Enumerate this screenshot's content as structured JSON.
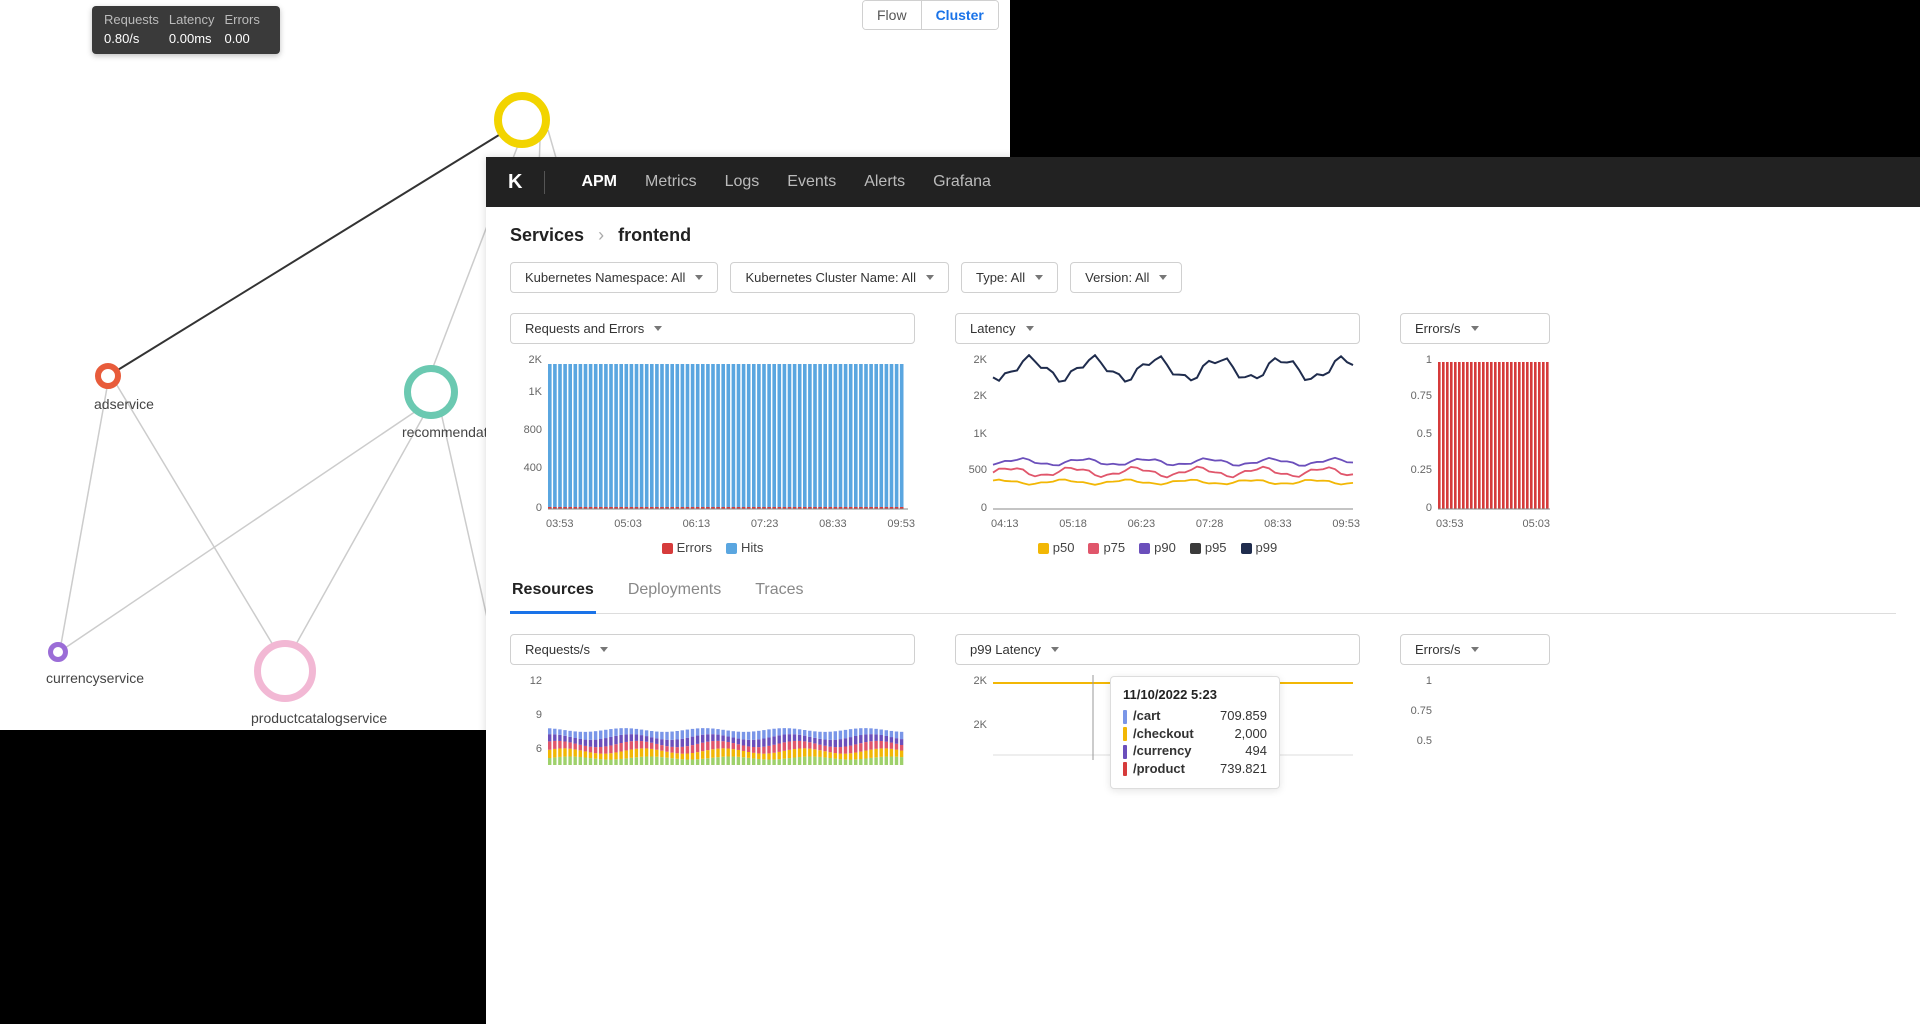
{
  "tooltip": {
    "headers": [
      "Requests",
      "Latency",
      "Errors"
    ],
    "values": [
      "0.80/s",
      "0.00ms",
      "0.00"
    ]
  },
  "view_toggle": {
    "flow": "Flow",
    "cluster": "Cluster",
    "active": "cluster"
  },
  "graph_nodes": {
    "adservice": "adservice",
    "recommendation": "recommendat",
    "currencyservice": "currencyservice",
    "productcatalogservice": "productcatalogservice"
  },
  "nav": {
    "logo": "K",
    "items": [
      "APM",
      "Metrics",
      "Logs",
      "Events",
      "Alerts",
      "Grafana"
    ],
    "active": "APM"
  },
  "breadcrumb": {
    "root": "Services",
    "current": "frontend"
  },
  "filters": [
    "Kubernetes Namespace: All",
    "Kubernetes Cluster Name: All",
    "Type: All",
    "Version: All"
  ],
  "chart1": {
    "selector": "Requests and Errors",
    "y_ticks": [
      "2K",
      "1K",
      "800",
      "400",
      "0"
    ],
    "x_ticks": [
      "03:53",
      "05:03",
      "06:13",
      "07:23",
      "08:33",
      "09:53"
    ],
    "legend": [
      {
        "label": "Errors",
        "color": "#d63b3b"
      },
      {
        "label": "Hits",
        "color": "#5aa6e0"
      }
    ]
  },
  "chart2": {
    "selector": "Latency",
    "y_ticks": [
      "2K",
      "2K",
      "1K",
      "500",
      "0"
    ],
    "x_ticks": [
      "04:13",
      "05:18",
      "06:23",
      "07:28",
      "08:33",
      "09:53"
    ],
    "legend": [
      {
        "label": "p50",
        "color": "#f2b705"
      },
      {
        "label": "p75",
        "color": "#e0566b"
      },
      {
        "label": "p90",
        "color": "#6b4fbb"
      },
      {
        "label": "p95",
        "color": "#3a3a3a"
      },
      {
        "label": "p99",
        "color": "#1f2c4d"
      }
    ]
  },
  "chart3": {
    "selector": "Errors/s",
    "y_ticks": [
      "1",
      "0.75",
      "0.5",
      "0.25",
      "0"
    ],
    "x_ticks": [
      "03:53",
      "05:03"
    ]
  },
  "tabs": {
    "items": [
      "Resources",
      "Deployments",
      "Traces"
    ],
    "active": "Resources"
  },
  "lower_chart1": {
    "selector": "Requests/s",
    "y_ticks": [
      "12",
      "9",
      "6"
    ]
  },
  "lower_chart2": {
    "selector": "p99 Latency",
    "y_ticks": [
      "2K",
      "2K"
    ]
  },
  "lower_chart3": {
    "selector": "Errors/s",
    "y_ticks": [
      "1",
      "0.75",
      "0.5"
    ]
  },
  "hover_tooltip": {
    "date": "11/10/2022 5:23",
    "rows": [
      {
        "label": "/cart",
        "value": "709.859",
        "color": "#7a96e8"
      },
      {
        "label": "/checkout",
        "value": "2,000",
        "color": "#f2b705"
      },
      {
        "label": "/currency",
        "value": "494",
        "color": "#6b4fbb"
      },
      {
        "label": "/product",
        "value": "739.821",
        "color": "#d63b3b"
      }
    ]
  },
  "chart_data": [
    {
      "type": "bar",
      "title": "Requests and Errors",
      "y_axis": [
        "0",
        "400",
        "800",
        "1K",
        "2K"
      ],
      "x_axis": [
        "03:53",
        "05:03",
        "06:13",
        "07:23",
        "08:33",
        "09:53"
      ],
      "series": [
        {
          "name": "Hits",
          "approx_constant": 1700
        },
        {
          "name": "Errors",
          "approx_constant": 20
        }
      ],
      "note": "dense vertical bars, visually near-constant around ~1.7K hits with thin red error stripe at base"
    },
    {
      "type": "line",
      "title": "Latency",
      "y_axis": [
        "0",
        "500",
        "1K",
        "2K",
        "2K"
      ],
      "x_axis": [
        "04:13",
        "05:18",
        "06:23",
        "07:28",
        "08:33",
        "09:53"
      ],
      "series": [
        {
          "name": "p50",
          "approx_mean": 440
        },
        {
          "name": "p75",
          "approx_mean": 500
        },
        {
          "name": "p90",
          "approx_mean": 620
        },
        {
          "name": "p95",
          "approx_mean": 640
        },
        {
          "name": "p99",
          "approx_mean": 1950,
          "spiky": true
        }
      ]
    },
    {
      "type": "bar",
      "title": "Errors/s",
      "y_axis": [
        "0",
        "0.25",
        "0.5",
        "0.75",
        "1"
      ],
      "x_axis": [
        "03:53",
        "05:03"
      ],
      "approx_constant": 0.95
    },
    {
      "type": "bar",
      "title": "Requests/s",
      "y_axis": [
        "6",
        "9",
        "12"
      ],
      "note": "multi-color stacked thin bars ~8-9 height"
    },
    {
      "type": "line",
      "title": "p99 Latency",
      "y_axis": [
        "2K",
        "2K"
      ],
      "tooltip_sample": {
        "timestamp": "11/10/2022 5:23",
        "values": {
          "/cart": 709.859,
          "/checkout": 2000,
          "/currency": 494,
          "/product": 739.821
        }
      }
    }
  ]
}
